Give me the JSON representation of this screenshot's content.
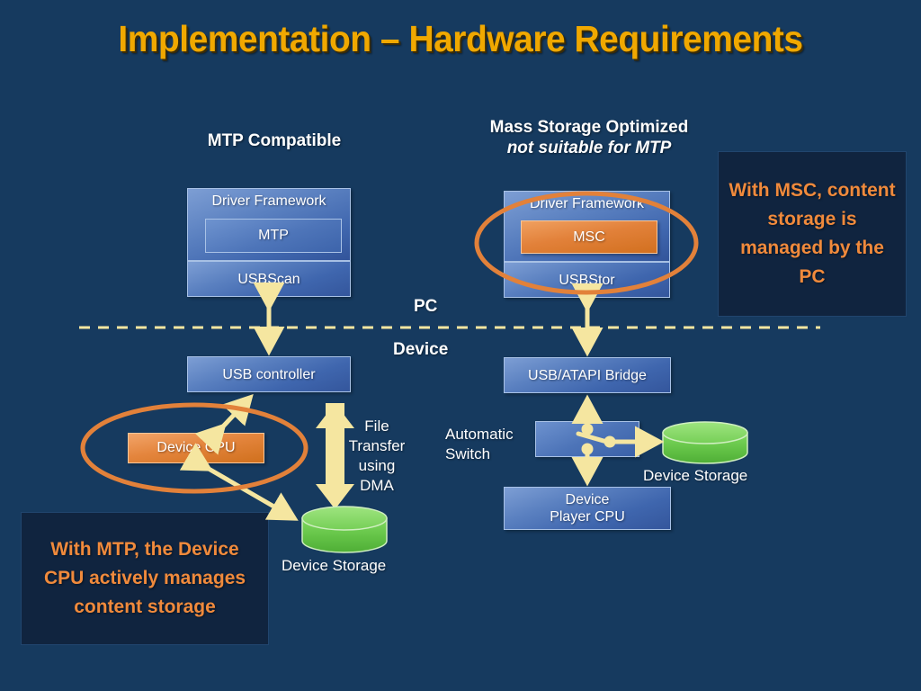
{
  "slide": {
    "title": "Implementation – Hardware Requirements",
    "background_color": "#163a5f",
    "title_color": "#f0a800"
  },
  "columns": {
    "left": {
      "heading": "MTP Compatible"
    },
    "right": {
      "heading": "Mass Storage Optimized",
      "subheading": "not suitable for MTP"
    }
  },
  "divider": {
    "above_label": "PC",
    "below_label": "Device"
  },
  "left_stack": {
    "framework_label": "Driver Framework",
    "inner_label": "MTP",
    "bottom_label": "USBScan"
  },
  "right_stack": {
    "framework_label": "Driver Framework",
    "inner_label": "MSC",
    "inner_color": "#e2813a",
    "bottom_label": "USBStor"
  },
  "left_device": {
    "usb_controller": "USB controller",
    "device_cpu": "Device CPU",
    "transfer_label": "File\nTransfer\nusing\nDMA",
    "transfer_line1": "File",
    "transfer_line2": "Transfer",
    "transfer_line3": "using",
    "transfer_line4": "DMA",
    "storage_label": "Device Storage"
  },
  "right_device": {
    "bridge": "USB/ATAPI Bridge",
    "switch_label_line1": "Automatic",
    "switch_label_line2": "Switch",
    "player_cpu_line1": "Device",
    "player_cpu_line2": "Player CPU",
    "storage_label": "Device Storage"
  },
  "callouts": {
    "msc": "With MSC, content storage is managed by the PC",
    "mtp": "With MTP, the Device CPU actively manages content storage",
    "text_color": "#f08a3c",
    "background_color": "#10243f"
  },
  "annotations": {
    "ellipse_color": "#e2813a",
    "arrow_color": "#f5e6a0",
    "storage_color": "#6ec84f"
  }
}
